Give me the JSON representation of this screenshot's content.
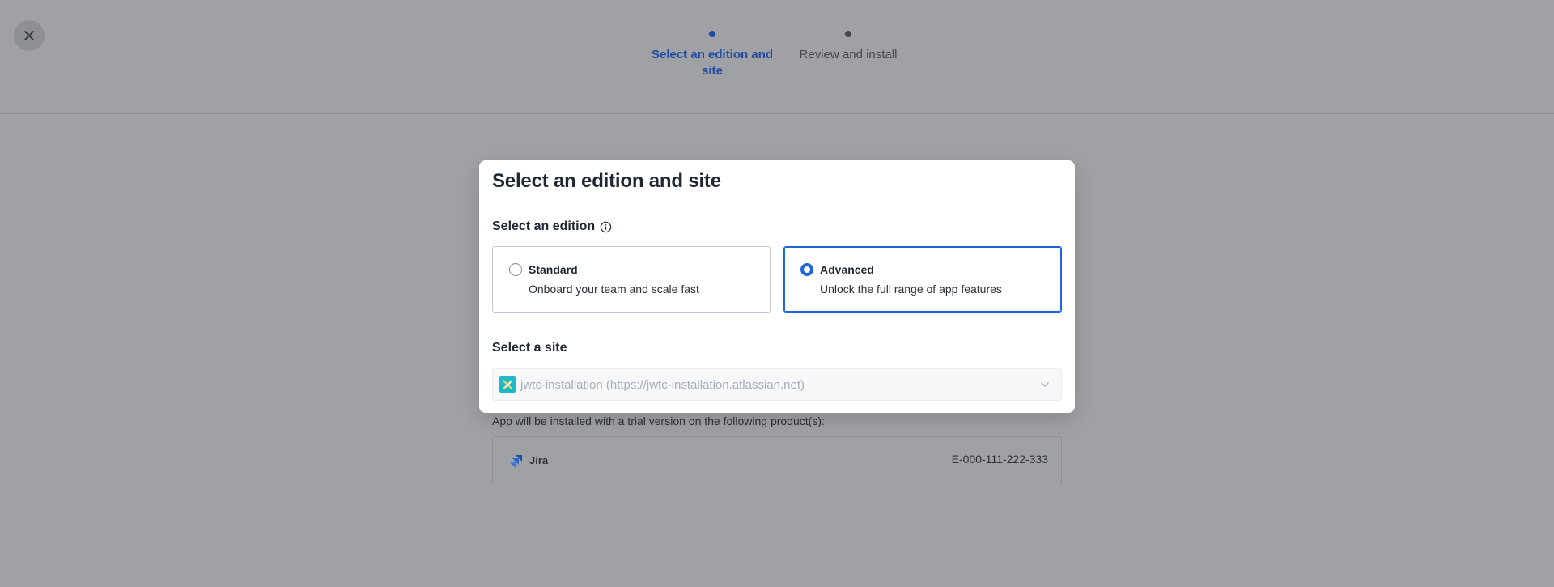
{
  "header": {
    "steps": [
      {
        "label": "Select an edition and site",
        "state": "active"
      },
      {
        "label": "Review and install",
        "state": "inactive"
      }
    ]
  },
  "icons": {
    "close": "close-icon",
    "info": "info-icon",
    "site_logo": "site-logo-icon",
    "chevron": "chevron-down-icon",
    "product": "jira-icon"
  },
  "colors": {
    "accent": "#1d66da",
    "step_active": "#1d4aa5",
    "overlay": "#a0a1a4"
  },
  "modal": {
    "title": "Select an edition and site",
    "edition_label": "Select an edition",
    "editions": [
      {
        "name": "Standard",
        "description": "Onboard your team and scale fast",
        "selected": false
      },
      {
        "name": "Advanced",
        "description": "Unlock the full range of app features",
        "selected": true
      }
    ],
    "site_label": "Select a site",
    "site_value": "jwtc-installation (https://jwtc-installation.atlassian.net)"
  },
  "background": {
    "install_text": "App will be installed with a trial version on the following product(s):",
    "product_name": "Jira",
    "product_code": "E-000-111-222-333"
  }
}
